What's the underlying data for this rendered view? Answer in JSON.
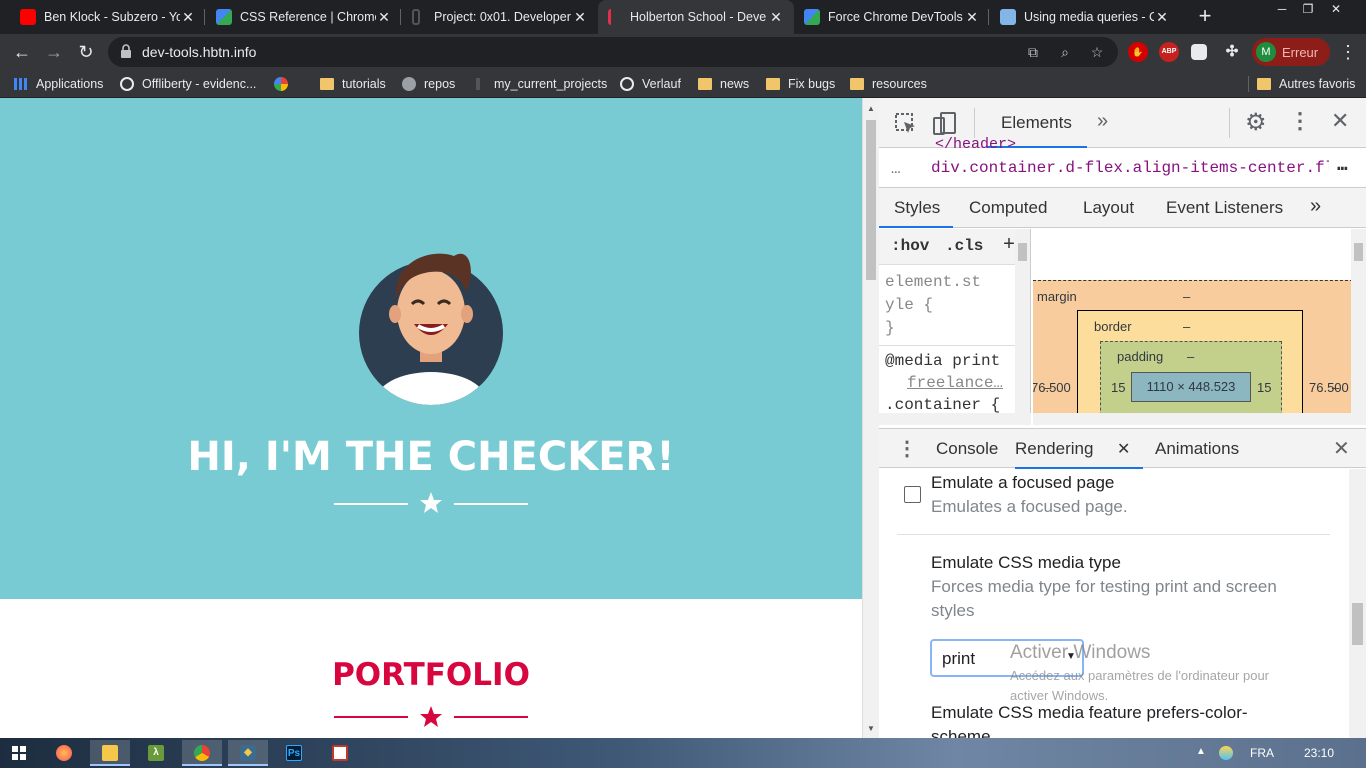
{
  "browser": {
    "tabs": [
      {
        "title": "Ben Klock - Subzero - Yo",
        "favicon": "youtube-icon"
      },
      {
        "title": "CSS Reference  |  Chrome",
        "favicon": "chrome-dev-icon"
      },
      {
        "title": "Project: 0x01. Developer",
        "favicon": "holberton-icon"
      },
      {
        "title": "Holberton School - Deve",
        "favicon": "holberton-icon",
        "active": true
      },
      {
        "title": "Force Chrome DevTools",
        "favicon": "chrome-dev-icon"
      },
      {
        "title": "Using media queries - CS",
        "favicon": "mdn-icon"
      }
    ],
    "url": "dev-tools.hbtn.info",
    "profile_label": "Erreur",
    "profile_initial": "M",
    "ext_abp": "ABP",
    "bookmarks": [
      {
        "label": "Applications",
        "icon": "apps-grid-icon"
      },
      {
        "label": "Offliberty - evidenc...",
        "icon": "power-icon"
      },
      {
        "label": "",
        "icon": "google-icon"
      },
      {
        "label": "tutorials",
        "icon": "folder-icon"
      },
      {
        "label": "repos",
        "icon": "github-icon"
      },
      {
        "label": "my_current_projects",
        "icon": "holberton-icon"
      },
      {
        "label": "Verlauf",
        "icon": "history-icon"
      },
      {
        "label": "news",
        "icon": "folder-icon"
      },
      {
        "label": "Fix bugs",
        "icon": "folder-icon"
      },
      {
        "label": "resources",
        "icon": "folder-icon"
      }
    ],
    "other_bookmarks": "Autres favoris"
  },
  "page": {
    "hero_title": "HI, I'M THE CHECKER!",
    "portfolio_title": "PORTFOLIO",
    "hero_color": "#79cbd3",
    "accent_color": "#d7063f"
  },
  "devtools": {
    "main_tab": "Elements",
    "breadcrumb_dots": "…",
    "breadcrumb": "div.container.d-flex.align-items-center.flex-column",
    "header_fragment": "</header>",
    "style_tabs": [
      "Styles",
      "Computed",
      "Layout",
      "Event Listeners"
    ],
    "filter_hov": ":hov",
    "filter_cls": ".cls",
    "styles_lines": [
      "element.st",
      "yle {",
      "}"
    ],
    "media_rule": "@media print",
    "media_link": "freelance…",
    "container_rule": ".container {",
    "box_model": {
      "margin_label": "margin",
      "margin_value": "–",
      "border_label": "border",
      "border_value": "–",
      "padding_label": "padding",
      "padding_value": "–",
      "left_outer": "76.500",
      "right_outer": "76.500",
      "left_border": "–",
      "right_border": "–",
      "padding_left": "15",
      "padding_right": "15",
      "content": "1110 × 448.523"
    },
    "drawer_tabs": [
      "Console",
      "Rendering",
      "Animations"
    ],
    "rendering": {
      "focused_title": "Emulate a focused page",
      "focused_desc": "Emulates a focused page.",
      "focused_checked": false,
      "media_title": "Emulate CSS media type",
      "media_desc_1": "Forces media type for testing print and screen",
      "media_desc_2": "styles",
      "media_value": "print",
      "color_scheme_title": "Emulate CSS media feature prefers-color-",
      "color_scheme_title_2": "scheme"
    }
  },
  "windows_watermark": {
    "title": "Activer Windows",
    "subtitle_1": "Accédez aux paramètres de l'ordinateur pour",
    "subtitle_2": "activer Windows."
  },
  "taskbar": {
    "language": "FRA",
    "time": "23:10",
    "ps_label": "Ps",
    "lambda_label": "λ"
  }
}
